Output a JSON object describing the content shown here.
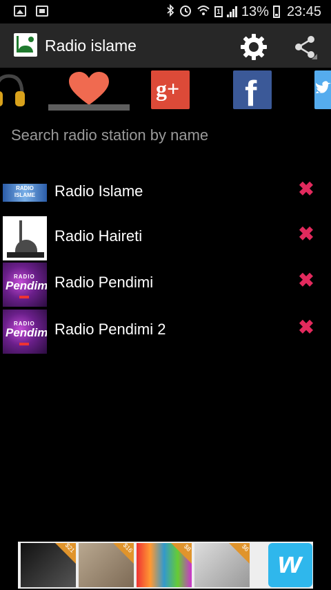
{
  "status_bar": {
    "bluetooth_icon": "bluetooth-icon",
    "alarm_icon": "alarm-icon",
    "wifi_icon": "wifi-icon",
    "sim_label": "1",
    "signal_icon": "signal-icon",
    "battery_percent": "13%",
    "time": "23:45"
  },
  "action_bar": {
    "title": "Radio islame",
    "settings_icon": "gear-icon",
    "share_icon": "share-icon"
  },
  "tabs": [
    {
      "name": "headphones",
      "icon": "headphones-icon",
      "selected": false
    },
    {
      "name": "favorites",
      "icon": "heart-icon",
      "selected": true
    },
    {
      "name": "google-plus",
      "icon": "google-plus-icon",
      "label": "g+"
    },
    {
      "name": "facebook",
      "icon": "facebook-icon",
      "label": "f"
    },
    {
      "name": "twitter",
      "icon": "twitter-icon"
    }
  ],
  "search": {
    "placeholder": "Search radio station by name",
    "value": ""
  },
  "stations": [
    {
      "name": "Radio Islame",
      "logo_text": "RADIO ISLAME"
    },
    {
      "name": "Radio Haireti"
    },
    {
      "name": "Radio Pendimi",
      "logo_top": "RADIO",
      "logo_main": "Pendimi"
    },
    {
      "name": "Radio Pendimi 2",
      "logo_top": "RADIO",
      "logo_main": "Pendimi"
    }
  ],
  "ad": {
    "badges": [
      "$21",
      "$16",
      "$8",
      "$6"
    ],
    "brand_glyph": "w"
  },
  "colors": {
    "delete": "#e22a5d",
    "heart": "#f06a50",
    "action_bar": "#272727",
    "google_plus": "#dc4a38",
    "facebook": "#3b5998",
    "twitter": "#55acee"
  }
}
